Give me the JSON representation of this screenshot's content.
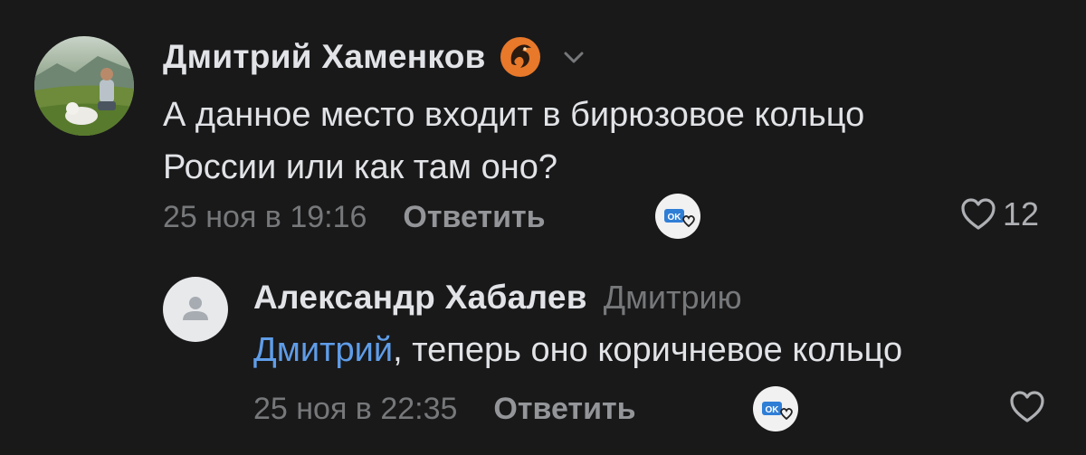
{
  "comments": [
    {
      "author": "Дмитрий Хаменков",
      "text_lines": [
        "А данное место входит в бирюзовое кольцо",
        "России или как там оно?"
      ],
      "date": "25 ноя в 19:16",
      "reply_label": "Ответить",
      "likes": "12",
      "ok_badge": "OK"
    },
    {
      "author": "Александр Хабалев",
      "addressee": "Дмитрию",
      "mention": "Дмитрий",
      "text_rest": ", теперь оно коричневое кольцо",
      "date": "25 ноя в 22:35",
      "reply_label": "Ответить",
      "ok_badge": "OK"
    }
  ],
  "colors": {
    "background": "#19191a",
    "text": "#e1e3e6",
    "secondary": "#76787a",
    "mention": "#5f9de8",
    "badge_orange": "#e8782a"
  }
}
